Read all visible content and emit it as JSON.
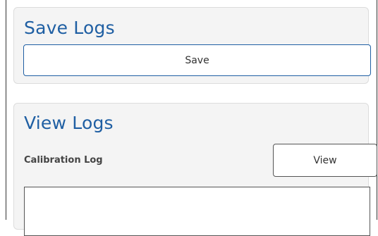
{
  "save_section": {
    "title": "Save Logs",
    "save_button_label": "Save"
  },
  "view_section": {
    "title": "View Logs",
    "calibration_label": "Calibration Log",
    "view_button_label": "View",
    "log_content": ""
  },
  "colors": {
    "accent": "#1f5fa3",
    "panel_background": "#f4f4f4",
    "panel_border": "#dcdcdc"
  }
}
